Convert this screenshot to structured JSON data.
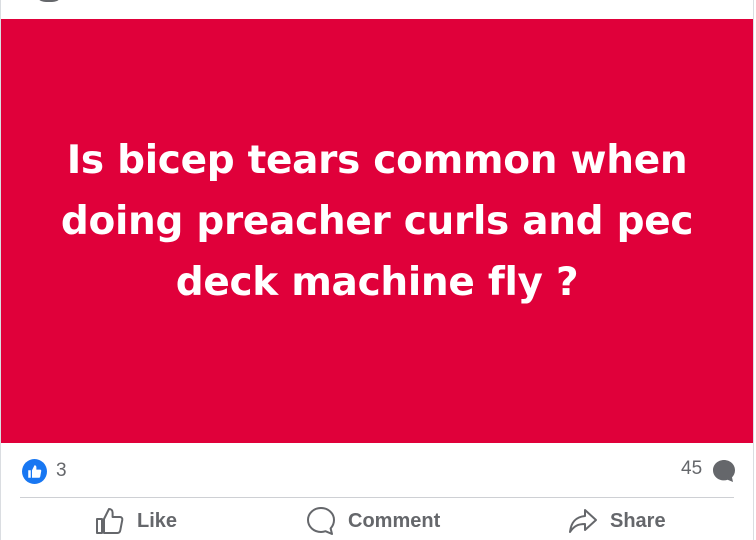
{
  "post": {
    "image_text": "Is bicep tears common when doing preacher curls and pec deck machine fly ?",
    "image_bg_color": "#e0003a"
  },
  "reactions": {
    "icon": "like-icon",
    "count": "3",
    "comment_count": "45",
    "comment_icon": "comment-bubble-icon"
  },
  "actions": {
    "like_label": "Like",
    "comment_label": "Comment",
    "share_label": "Share"
  },
  "colors": {
    "accent": "#1877f2",
    "secondary_text": "#65676b"
  }
}
